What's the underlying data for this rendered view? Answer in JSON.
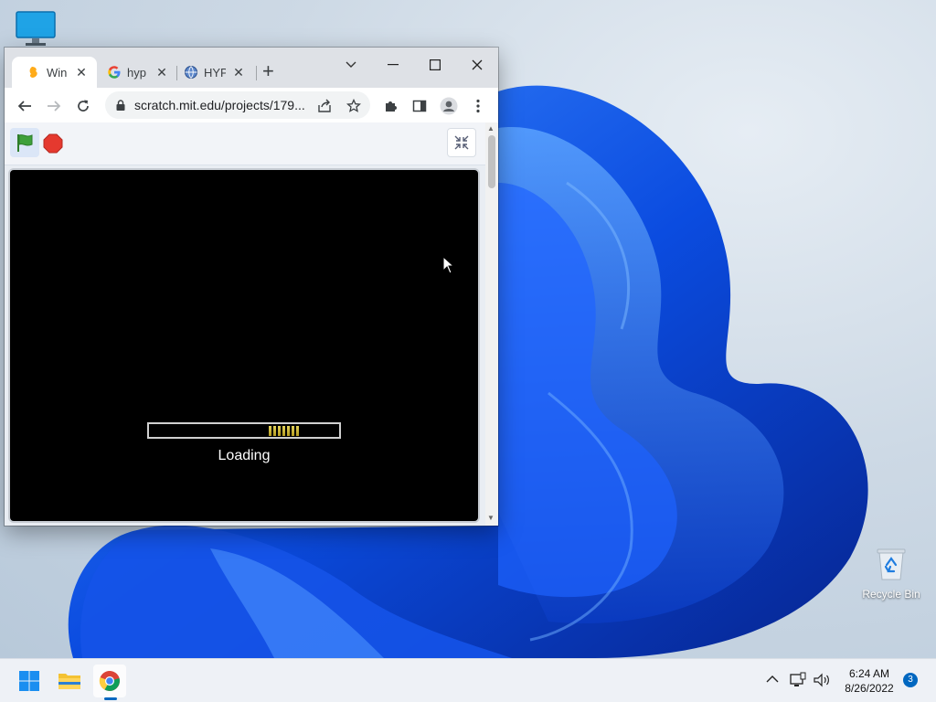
{
  "desktop": {
    "recycle_bin_label": "Recycle Bin"
  },
  "browser": {
    "tabs": [
      {
        "title": "Win",
        "active": true,
        "favicon": "scratch-favicon"
      },
      {
        "title": "hyp",
        "active": false,
        "favicon": "google-favicon"
      },
      {
        "title": "HYP",
        "active": false,
        "favicon": "globe-favicon"
      }
    ],
    "close_glyph": "✕",
    "new_tab_glyph": "+",
    "address": "scratch.mit.edu/projects/179..."
  },
  "scratch_player": {
    "loading_text": "Loading",
    "progress_fraction": 0.12,
    "progress_segments": 7
  },
  "taskbar": {
    "clock_time": "6:24 AM",
    "clock_date": "8/26/2022",
    "notification_count": "3",
    "apps": [
      "start",
      "file-explorer",
      "chrome"
    ]
  },
  "colors": {
    "accent": "#0067c0",
    "progress_fill": "#c8b33a",
    "stop": "#e5392f",
    "flag": "#3ea03a"
  }
}
